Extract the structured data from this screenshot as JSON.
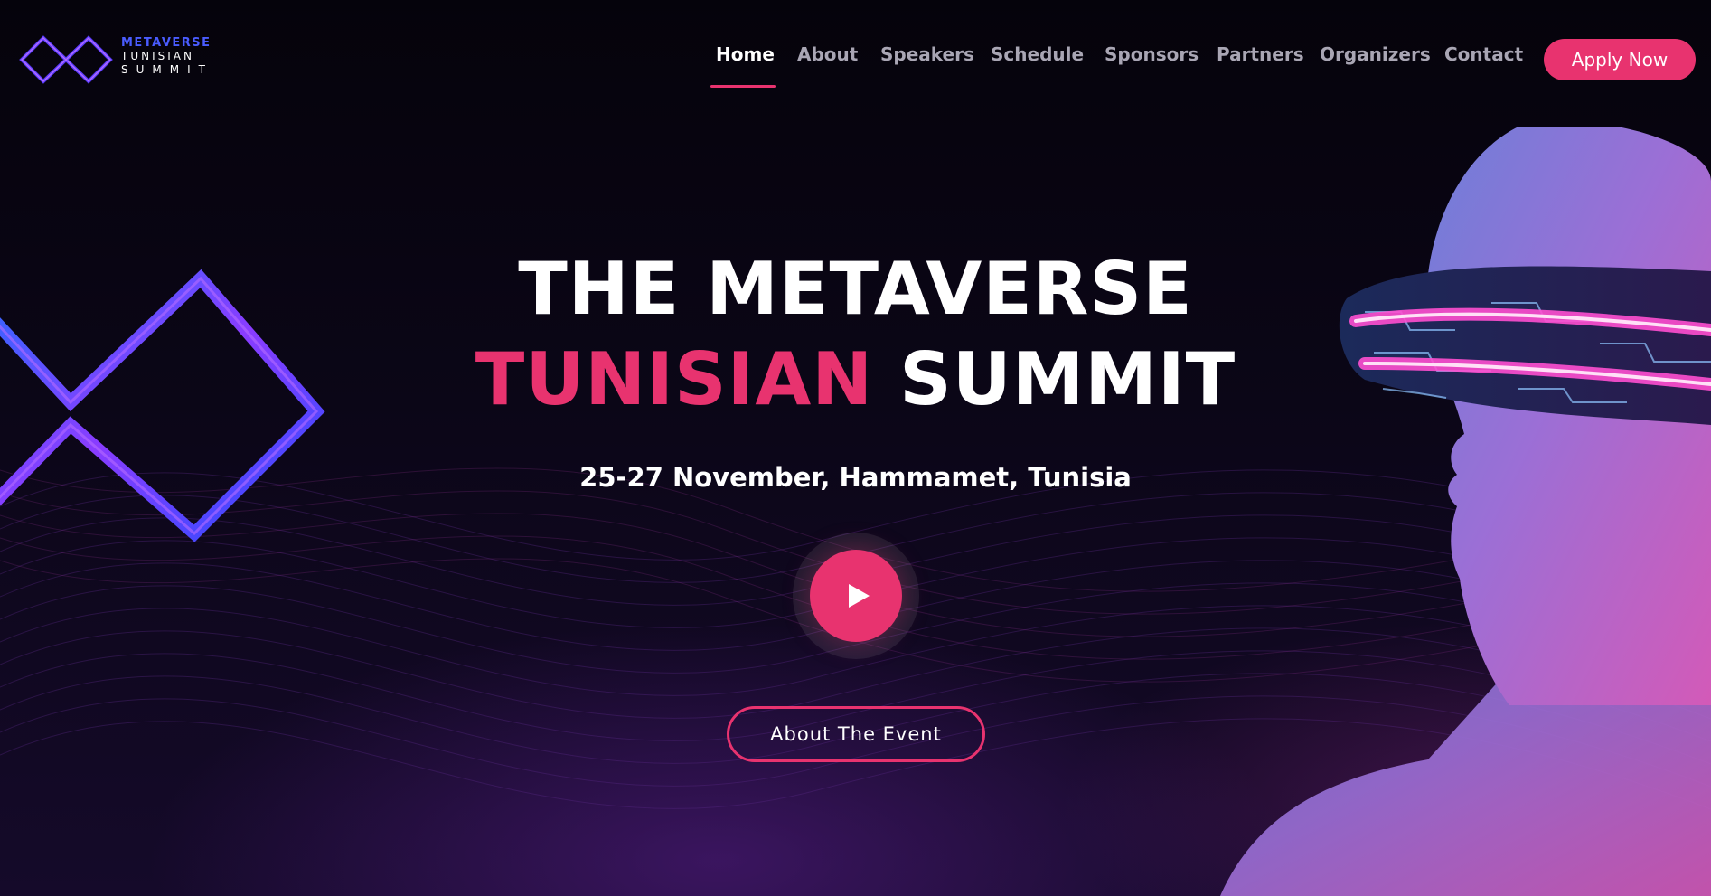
{
  "logo": {
    "line1": "METAVERSE",
    "line2": "TUNISIAN",
    "line3": "SUMMIT",
    "icon": "infinity-diamond-logo-icon"
  },
  "nav": {
    "items": [
      {
        "label": "Home",
        "active": true
      },
      {
        "label": "About",
        "active": false
      },
      {
        "label": "Speakers",
        "active": false
      },
      {
        "label": "Schedule",
        "active": false
      },
      {
        "label": "Sponsors",
        "active": false
      },
      {
        "label": "Partners",
        "active": false
      },
      {
        "label": "Organizers",
        "active": false
      },
      {
        "label": "Contact",
        "active": false
      }
    ],
    "apply_label": "Apply Now"
  },
  "hero": {
    "title_line1": "THE METAVERSE",
    "title_line2_accent": "TUNISIAN",
    "title_line2_rest": "SUMMIT",
    "date_location": "25-27 November, Hammamet, Tunisia",
    "play_icon": "play-icon",
    "about_button": "About The Event"
  },
  "colors": {
    "accent": "#e8336f",
    "background": "#06040d",
    "logo_blue": "#4a5cff",
    "nav_inactive": "#a9a6b4"
  }
}
